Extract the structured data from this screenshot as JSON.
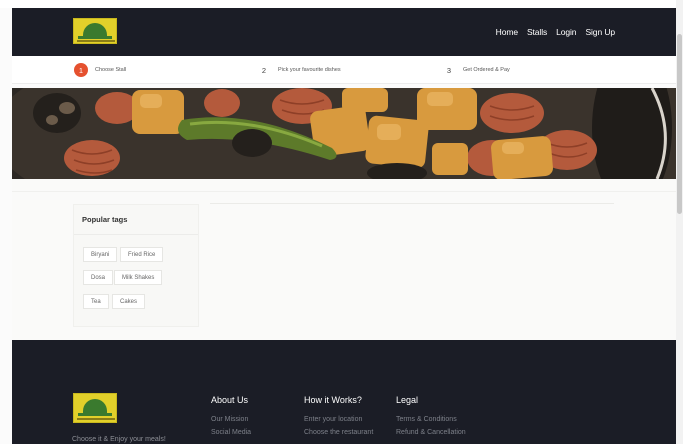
{
  "navbar": {
    "logo_icon": "stall-dome-logo",
    "links": [
      "Home",
      "Stalls",
      "Login",
      "Sign Up"
    ]
  },
  "steps": [
    {
      "number": "1",
      "label": "Choose Stall",
      "active": true
    },
    {
      "number": "2",
      "label": "Pick your favourite dishes",
      "active": false
    },
    {
      "number": "3",
      "label": "Get Ordered & Pay",
      "active": false
    }
  ],
  "sidebar": {
    "title": "Popular tags",
    "tags": [
      "Biryani",
      "Fried Rice",
      "Dosa",
      "Milk Shakes",
      "Tea",
      "Cakes"
    ]
  },
  "footer": {
    "tagline": "Choose it & Enjoy your meals!",
    "columns": [
      {
        "heading": "About Us",
        "items": [
          "Our Mission",
          "Social Media"
        ]
      },
      {
        "heading": "How it Works?",
        "items": [
          "Enter your location",
          "Choose the restaurant"
        ]
      },
      {
        "heading": "Legal",
        "items": [
          "Terms & Conditions",
          "Refund & Cancellation"
        ]
      }
    ]
  },
  "colors": {
    "navbar_bg": "#1b1d26",
    "accent": "#e5512f",
    "logo_yellow": "#e2d02a",
    "logo_green": "#3a7a2e"
  }
}
